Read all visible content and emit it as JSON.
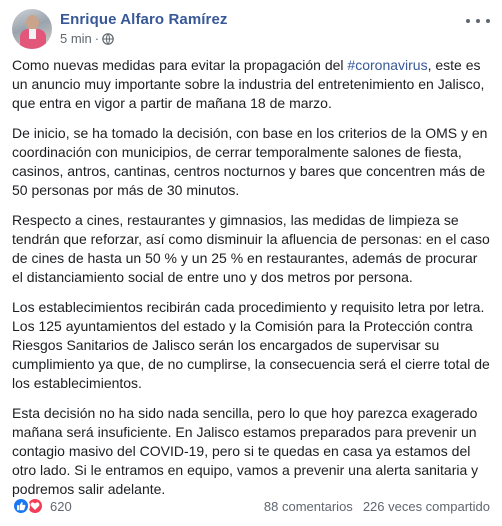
{
  "post": {
    "author": "Enrique Alfaro Ramírez",
    "time": "5 min",
    "separator": "·",
    "paragraphs": [
      {
        "before": "Como nuevas medidas para evitar la propagación del ",
        "hashtag": "#coronavirus",
        "after": ", este es un anuncio muy importante sobre la industria del entretenimiento en Jalisco, que entra en vigor a partir de mañana 18 de marzo."
      },
      "De inicio, se ha tomado la decisión, con base en los criterios de la OMS y en coordinación con municipios, de cerrar temporalmente salones de fiesta, casinos, antros, cantinas, centros nocturnos y bares que concentren más de 50 personas por más de 30 minutos.",
      "Respecto a cines, restaurantes y gimnasios, las medidas de limpieza se tendrán que reforzar, así como disminuir la afluencia de personas: en el caso de cines de hasta un 50 % y un 25 % en restaurantes, además de procurar el distanciamiento social de entre uno y dos metros por persona.",
      "Los establecimientos recibirán cada procedimiento y requisito letra por letra. Los 125 ayuntamientos del estado y la Comisión para la Protección contra Riesgos Sanitarios de Jalisco serán los encargados de supervisar su cumplimiento ya que, de no cumplirse, la consecuencia será el cierre total de los establecimientos.",
      "Esta decisión no ha sido nada sencilla, pero lo que hoy parezca exagerado mañana será insuficiente. En Jalisco estamos preparados para prevenir un contagio masivo del COVID-19, pero si te quedas en casa ya estamos del otro lado. Si le entramos en equipo, vamos a prevenir una alerta sanitaria y podremos salir adelante."
    ]
  },
  "stats": {
    "reactions_count": "620",
    "comments": "88 comentarios",
    "shares": "226 veces compartido"
  },
  "icons": {
    "like": "like-icon",
    "love": "love-icon",
    "globe": "globe-icon",
    "more": "more-options-icon"
  },
  "colors": {
    "link": "#385898",
    "like": "#1877f2",
    "love": "#f33e58"
  }
}
